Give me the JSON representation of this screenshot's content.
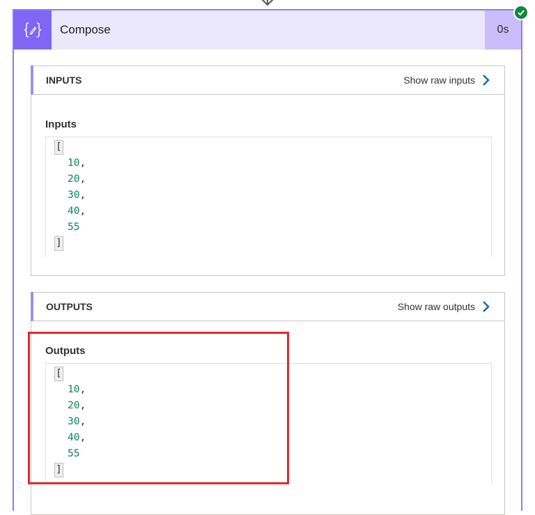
{
  "action": {
    "title": "Compose",
    "duration": "0s",
    "status": "succeeded"
  },
  "inputs_section": {
    "header": "INPUTS",
    "raw_link_label": "Show raw inputs",
    "field_label": "Inputs",
    "open_bracket": "[",
    "close_bracket": "]",
    "values": [
      "10,",
      "20,",
      "30,",
      "40,",
      "55"
    ]
  },
  "outputs_section": {
    "header": "OUTPUTS",
    "raw_link_label": "Show raw outputs",
    "field_label": "Outputs",
    "open_bracket": "[",
    "close_bracket": "]",
    "values": [
      "10,",
      "20,",
      "30,",
      "40,",
      "55"
    ]
  },
  "colors": {
    "accent": "#7f66f5",
    "header_bg": "#ebe7fd",
    "number_color": "#098658",
    "success": "#11873b",
    "highlight": "#e0282e"
  },
  "icons": {
    "header_icon": "compose-braces-icon",
    "status_icon": "check-circle-icon",
    "link_icon": "chevron-right-icon"
  }
}
